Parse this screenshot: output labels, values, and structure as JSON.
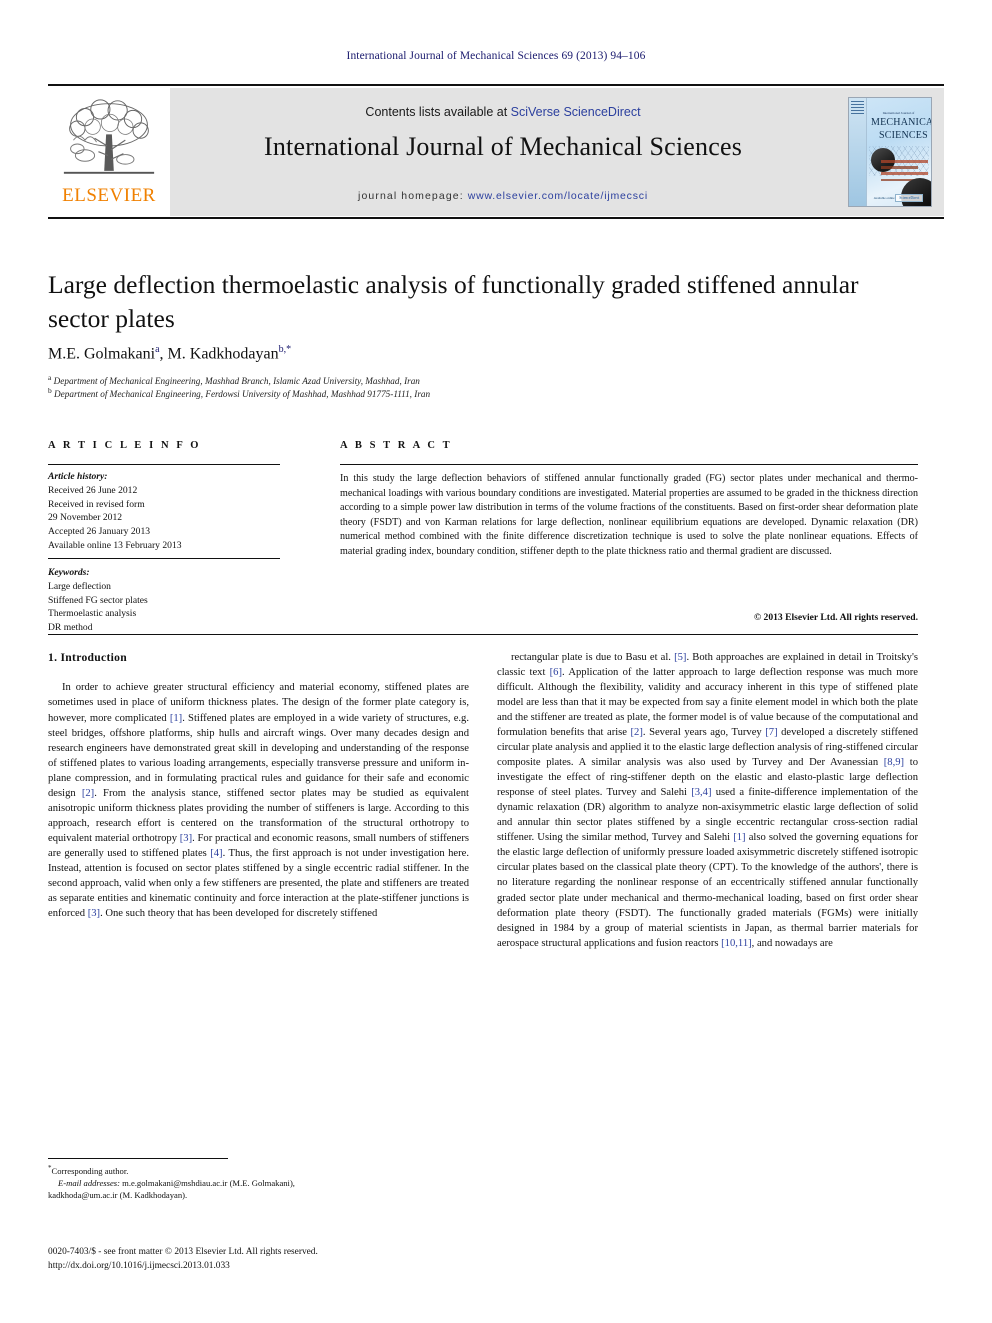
{
  "running_head": "International Journal of Mechanical Sciences 69 (2013) 94–106",
  "masthead": {
    "contents_prefix": "Contents lists available at ",
    "contents_link": "SciVerse ScienceDirect",
    "journal_title": "International Journal of Mechanical Sciences",
    "homepage_prefix": "journal homepage: ",
    "homepage_link": "www.elsevier.com/locate/ijmecsci",
    "publisher_logo_text": "ELSEVIER",
    "cover": {
      "top_line": "International Journal of",
      "title_line1": "MECHANICAL",
      "title_line2": "SCIENCES",
      "footer_text": "Available online",
      "footer_badge": "ScienceDirect"
    }
  },
  "article": {
    "title": "Large deflection thermoelastic analysis of functionally graded stiffened annular sector plates",
    "authors_html": "M.E. Golmakani<sup>a</sup>, M. Kadkhodayan<sup>b,*</sup>",
    "affiliation_a": "Department of Mechanical Engineering, Mashhad Branch, Islamic Azad University, Mashhad, Iran",
    "affiliation_b": "Department of Mechanical Engineering, Ferdowsi University of Mashhad, Mashhad 91775-1111, Iran"
  },
  "article_info": {
    "heading": "A R T I C L E  I N F O",
    "history_label": "Article history:",
    "history": [
      "Received 26 June 2012",
      "Received in revised form",
      "29 November 2012",
      "Accepted 26 January 2013",
      "Available online 13 February 2013"
    ],
    "keywords_label": "Keywords:",
    "keywords": [
      "Large deflection",
      "Stiffened FG sector plates",
      "Thermoelastic analysis",
      "DR method"
    ]
  },
  "abstract": {
    "heading": "A B S T R A C T",
    "text": "In this study the large deflection behaviors of stiffened annular functionally graded (FG) sector plates under mechanical and thermo-mechanical loadings with various boundary conditions are investigated. Material properties are assumed to be graded in the thickness direction according to a simple power law distribution in terms of the volume fractions of the constituents. Based on first-order shear deformation plate theory (FSDT) and von Karman relations for large deflection, nonlinear equilibrium equations are developed. Dynamic relaxation (DR) numerical method combined with the finite difference discretization technique is used to solve the plate nonlinear equations. Effects of material grading index, boundary condition, stiffener depth to the plate thickness ratio and thermal gradient are discussed.",
    "copyright": "© 2013 Elsevier Ltd. All rights reserved."
  },
  "body": {
    "section_heading": "1. Introduction",
    "left_column_html": "In order to achieve greater structural efficiency and material economy, stiffened plates are sometimes used in place of uniform thickness plates. The design of the former plate category is, however, more complicated <span class=\"ref\">[1]</span>. Stiffened plates are employed in a wide variety of structures, e.g. steel bridges, offshore platforms, ship hulls and aircraft wings. Over many decades design and research engineers have demonstrated great skill in developing and understanding of the response of stiffened plates to various loading arrangements, especially transverse pressure and uniform in-plane compression, and in formulating practical rules and guidance for their safe and economic design <span class=\"ref\">[2]</span>. From the analysis stance, stiffened sector plates may be studied as equivalent anisotropic uniform thickness plates providing the number of stiffeners is large. According to this approach, research effort is centered on the transformation of the structural orthotropy to equivalent material orthotropy <span class=\"ref\">[3]</span>. For practical and economic reasons, small numbers of stiffeners are generally used to stiffened plates <span class=\"ref\">[4]</span>. Thus, the first approach is not under investigation here. Instead, attention is focused on sector plates stiffened by a single eccentric radial stiffener. In the second approach, valid when only a few stiffeners are presented, the plate and stiffeners are treated as separate entities and kinematic continuity and force interaction at the plate-stiffener junctions is enforced <span class=\"ref\">[3]</span>. One such theory that has been developed for discretely stiffened",
    "right_column_html": "rectangular plate is due to Basu et al. <span class=\"ref\">[5]</span>. Both approaches are explained in detail in Troitsky's classic text <span class=\"ref\">[6]</span>. Application of the latter approach to large deflection response was much more difficult. Although the flexibility, validity and accuracy inherent in this type of stiffened plate model are less than that it may be expected from say a finite element model in which both the plate and the stiffener are treated as plate, the former model is of value because of the computational and formulation benefits that arise <span class=\"ref\">[2]</span>. Several years ago, Turvey <span class=\"ref\">[7]</span> developed a discretely stiffened circular plate analysis and applied it to the elastic large deflection analysis of ring-stiffened circular composite plates. A similar analysis was also used by Turvey and Der Avanessian <span class=\"ref\">[8,9]</span> to investigate the effect of ring-stiffener depth on the elastic and elasto-plastic large deflection response of steel plates. Turvey and Salehi <span class=\"ref\">[3,4]</span> used a finite-difference implementation of the dynamic relaxation (DR) algorithm to analyze non-axisymmetric elastic large deflection of solid and annular thin sector plates stiffened by a single eccentric rectangular cross-section radial stiffener. Using the similar method, Turvey and Salehi <span class=\"ref\">[1]</span> also solved the governing equations for the elastic large deflection of uniformly pressure loaded axisymmetric discretely stiffened isotropic circular plates based on the classical plate theory (CPT). To the knowledge of the authors', there is no literature regarding the nonlinear response of an eccentrically stiffened annular functionally graded sector plate under mechanical and thermo-mechanical loading, based on first order shear deformation plate theory (FSDT). The functionally graded materials (FGMs) were initially designed in 1984 by a group of material scientists in Japan, as thermal barrier materials for aerospace structural applications and fusion reactors <span class=\"ref\">[10,11]</span>, and nowadays are"
  },
  "footer": {
    "corresponding_marker": "*",
    "corresponding_label": "Corresponding author.",
    "email_label": "E-mail addresses:",
    "email_line1": " m.e.golmakani@mshdiau.ac.ir (M.E. Golmakani),",
    "email_line2": "kadkhoda@um.ac.ir (M. Kadkhodayan).",
    "issn_line": "0020-7403/$ - see front matter © 2013 Elsevier Ltd. All rights reserved.",
    "doi_line": "http://dx.doi.org/10.1016/j.ijmecsci.2013.01.033"
  }
}
